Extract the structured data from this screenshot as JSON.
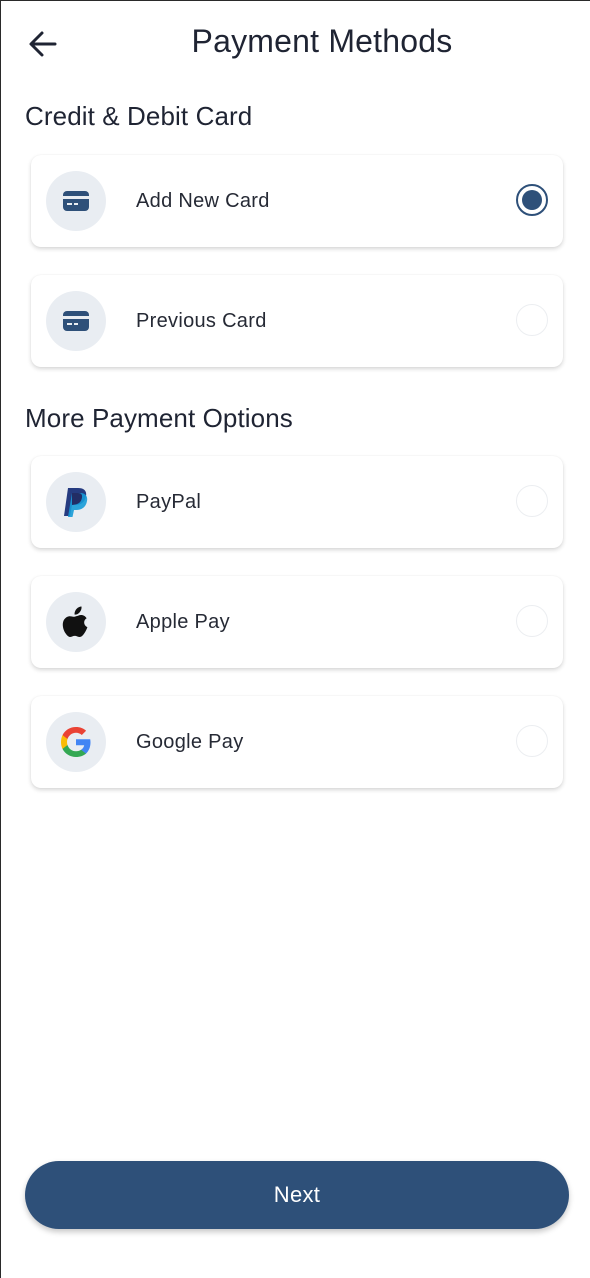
{
  "header": {
    "title": "Payment Methods",
    "back_icon": "arrow-left-icon"
  },
  "sections": {
    "cards_title": "Credit & Debit Card",
    "more_title": "More Payment Options"
  },
  "options": {
    "add_new_card": {
      "label": "Add New Card",
      "icon": "credit-card-icon",
      "selected": true
    },
    "previous_card": {
      "label": "Previous Card",
      "icon": "credit-card-icon",
      "selected": false
    },
    "paypal": {
      "label": "PayPal",
      "icon": "paypal-logo-icon",
      "selected": false
    },
    "apple_pay": {
      "label": "Apple Pay",
      "icon": "apple-logo-icon",
      "selected": false
    },
    "google_pay": {
      "label": "Google Pay",
      "icon": "google-logo-icon",
      "selected": false
    }
  },
  "footer": {
    "next_label": "Next"
  },
  "colors": {
    "accent": "#2e5079",
    "icon_bg": "#e9edf2",
    "text": "#1f2433",
    "paypal_dark": "#253b80",
    "paypal_light": "#179bd7",
    "google_blue": "#4285f4",
    "google_red": "#ea4335",
    "google_yellow": "#fbbc05",
    "google_green": "#34a853"
  }
}
